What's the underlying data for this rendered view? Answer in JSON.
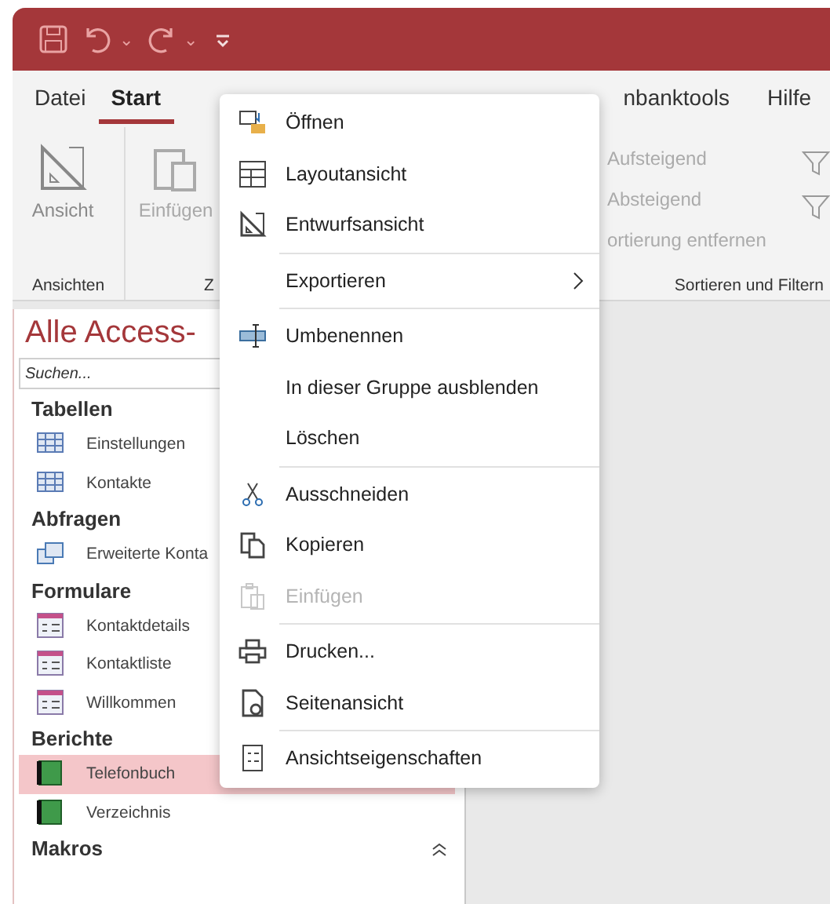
{
  "quick_access": {
    "caret_labels": [
      "⌄",
      "⌄"
    ]
  },
  "ribbon_tabs": [
    {
      "label": "Datei",
      "selected": false
    },
    {
      "label": "Start",
      "selected": true
    },
    {
      "label": "nbanktools",
      "selected": false
    },
    {
      "label": "Hilfe",
      "selected": false
    }
  ],
  "ribbon": {
    "left_buttons": [
      {
        "label": "Ansicht",
        "disabled": false
      },
      {
        "label": "Einfügen",
        "disabled": true
      }
    ],
    "group_labels": [
      "Ansichten",
      "Z"
    ],
    "sort_commands": [
      "Aufsteigend",
      "Absteigend",
      "ortierung entfernen"
    ],
    "sort_group_label": "Sortieren und Filtern"
  },
  "navigation": {
    "title": "Alle Access-",
    "search": {
      "placeholder": "Suchen..."
    },
    "groups": [
      {
        "label": "Tabellen",
        "kind": "table",
        "items": [
          {
            "label": "Einstellungen",
            "selected": false
          },
          {
            "label": "Kontakte",
            "selected": false
          }
        ]
      },
      {
        "label": "Abfragen",
        "kind": "query",
        "items": [
          {
            "label": "Erweiterte Konta",
            "selected": false
          }
        ]
      },
      {
        "label": "Formulare",
        "kind": "form",
        "items": [
          {
            "label": "Kontaktdetails",
            "selected": false
          },
          {
            "label": "Kontaktliste",
            "selected": false
          },
          {
            "label": "Willkommen",
            "selected": false
          }
        ]
      },
      {
        "label": "Berichte",
        "kind": "report",
        "items": [
          {
            "label": "Telefonbuch",
            "selected": true
          },
          {
            "label": "Verzeichnis",
            "selected": false
          }
        ]
      },
      {
        "label": "Makros",
        "expanded": true
      }
    ]
  },
  "context_menu": {
    "sections": [
      [
        {
          "label": "Öffnen",
          "disabled": false
        },
        {
          "label": "Layoutansicht",
          "disabled": false
        },
        {
          "label": "Entwurfsansicht",
          "disabled": false
        }
      ],
      [
        {
          "label": "Exportieren",
          "disabled": false,
          "submenu": true
        }
      ],
      [
        {
          "label": "Umbenennen",
          "disabled": false
        },
        {
          "label": "In dieser Gruppe ausblenden",
          "disabled": false
        },
        {
          "label": "Löschen",
          "disabled": false
        }
      ],
      [
        {
          "label": "Ausschneiden",
          "disabled": false
        },
        {
          "label": "Kopieren",
          "disabled": false
        },
        {
          "label": "Einfügen",
          "disabled": true
        }
      ],
      [
        {
          "label": "Drucken...",
          "disabled": false
        },
        {
          "label": "Seitenansicht",
          "disabled": false
        }
      ],
      [
        {
          "label": "Ansichtseigenschaften",
          "disabled": false
        }
      ]
    ]
  }
}
